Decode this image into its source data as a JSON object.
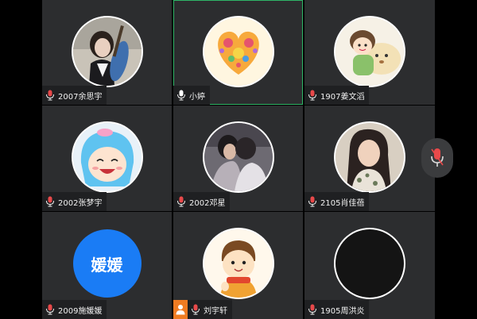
{
  "colors": {
    "background": "#000000",
    "tile": "#2c2d2f",
    "label_bg": "#1f2022",
    "active_border": "#2fb567",
    "mic_muted": "#e8494a",
    "mic_active": "#ffffff",
    "host_badge": "#f07c22",
    "blue_avatar": "#1a7cf5"
  },
  "participants": [
    {
      "name": "2007余思宇",
      "mic": "muted",
      "avatar": "photo-girl-guitar"
    },
    {
      "name": "小婷",
      "mic": "active",
      "avatar": "heart-illustration",
      "speaking": true
    },
    {
      "name": "1907姜文滔",
      "mic": "muted",
      "avatar": "cartoon-bear-boy"
    },
    {
      "name": "2002张梦宇",
      "mic": "muted",
      "avatar": "anime-blue-hair-girl"
    },
    {
      "name": "2002邓星",
      "mic": "muted",
      "avatar": "photo-couple"
    },
    {
      "name": "2105肖佳蓓",
      "mic": "muted",
      "avatar": "photo-woman"
    },
    {
      "name": "2009施媛媛",
      "mic": "muted",
      "avatar": "text-avatar",
      "avatar_text": "媛媛"
    },
    {
      "name": "刘宇轩",
      "mic": "muted",
      "avatar": "cartoon-boy-scarf",
      "host": true
    },
    {
      "name": "1905周洪炎",
      "mic": "muted",
      "avatar": "black-avatar"
    }
  ],
  "side_control": {
    "icon": "mic-muted-icon"
  }
}
